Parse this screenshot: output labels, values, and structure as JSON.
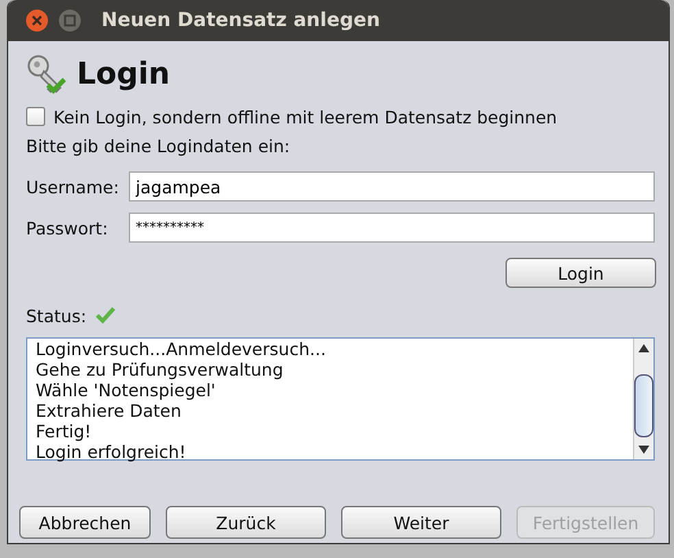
{
  "window": {
    "title": "Neuen Datensatz anlegen"
  },
  "heading": "Login",
  "offline_checkbox": {
    "label": "Kein Login, sondern offline mit leerem Datensatz beginnen",
    "checked": false
  },
  "instruction": "Bitte gib deine Logindaten ein:",
  "fields": [
    {
      "label": "Username:",
      "value": "jagampea",
      "kind": "text"
    },
    {
      "label": "Passwort:",
      "value": "**********",
      "kind": "password"
    }
  ],
  "login_button": "Login",
  "status": {
    "label": "Status:",
    "ok": true
  },
  "log": [
    "Loginversuch...Anmeldeversuch...",
    "Gehe zu Prüfungsverwaltung",
    "Wähle 'Notenspiegel'",
    "Extrahiere Daten",
    "Fertig!",
    "Login erfolgreich!"
  ],
  "buttons": [
    {
      "label": "Abbrechen",
      "disabled": false
    },
    {
      "label": "Zurück",
      "disabled": false
    },
    {
      "label": "Weiter",
      "disabled": false
    },
    {
      "label": "Fertigstellen",
      "disabled": true
    }
  ]
}
